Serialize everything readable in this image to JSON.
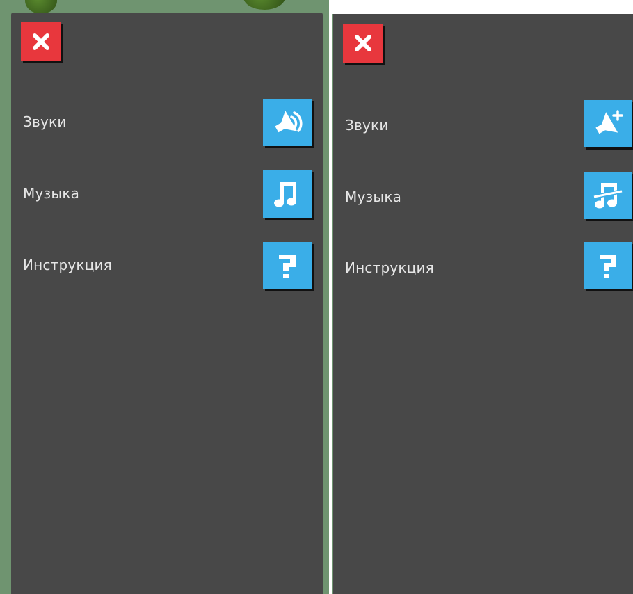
{
  "colors": {
    "panel_bg": "#484848",
    "close_button": "#e8373d",
    "setting_button": "#3aaee8",
    "label_text": "#e6e6e6",
    "game_backdrop": "#6f9470"
  },
  "panels": [
    {
      "state": "sound-on",
      "close_icon": "close-icon",
      "settings": [
        {
          "label": "Звуки",
          "icon": "speaker-on-icon"
        },
        {
          "label": "Музыка",
          "icon": "music-note-icon"
        },
        {
          "label": "Инструкция",
          "icon": "question-icon"
        }
      ]
    },
    {
      "state": "sound-off",
      "close_icon": "close-icon",
      "settings": [
        {
          "label": "Звуки",
          "icon": "speaker-off-icon"
        },
        {
          "label": "Музыка",
          "icon": "music-note-off-icon"
        },
        {
          "label": "Инструкция",
          "icon": "question-icon"
        }
      ]
    }
  ]
}
